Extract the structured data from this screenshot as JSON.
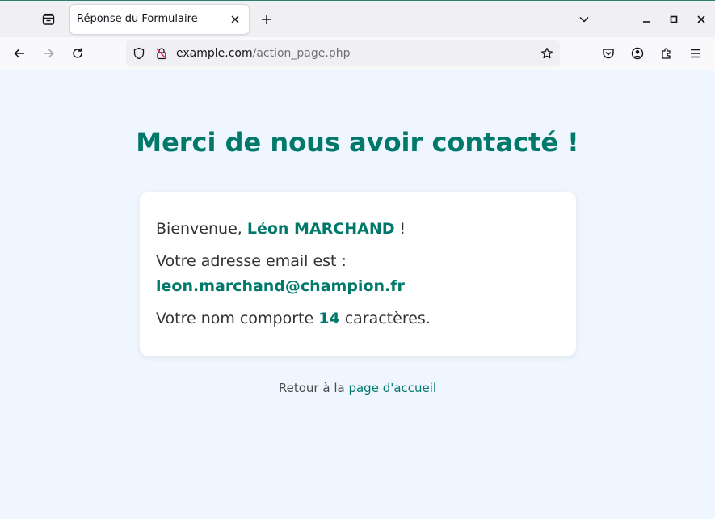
{
  "browser": {
    "tab_title": "Réponse du Formulaire",
    "url_host": "example.com",
    "url_path": "/action_page.php"
  },
  "page": {
    "heading": "Merci de nous avoir contacté !",
    "welcome_prefix": "Bienvenue, ",
    "name": "Léon MARCHAND",
    "welcome_suffix": " !",
    "email_prefix": "Votre adresse email est :",
    "email": "leon.marchand@champion.fr",
    "count_prefix": "Votre nom comporte ",
    "count": "14",
    "count_suffix": " caractères.",
    "footer_prefix": "Retour à la ",
    "footer_link": "page d'accueil"
  },
  "colors": {
    "accent": "#00796b",
    "page_bg": "#eff6ff",
    "card_bg": "#ffffff"
  },
  "icons": [
    "tab-list-icon",
    "close-icon",
    "plus-icon",
    "chevron-down-icon",
    "minimize-icon",
    "maximize-icon",
    "window-close-icon",
    "back-arrow-icon",
    "forward-arrow-icon",
    "reload-icon",
    "shield-icon",
    "insecure-lock-icon",
    "star-icon",
    "pocket-icon",
    "account-icon",
    "extensions-icon",
    "hamburger-menu-icon"
  ]
}
